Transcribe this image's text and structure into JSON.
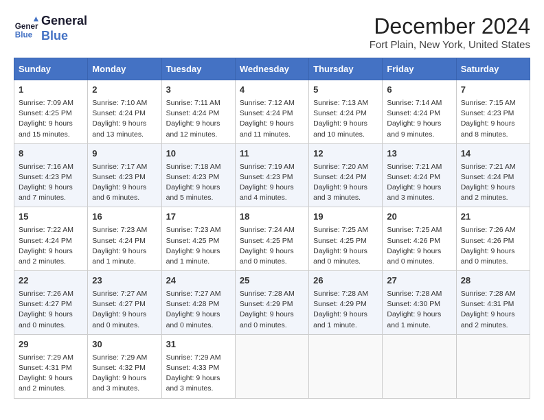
{
  "header": {
    "logo_line1": "General",
    "logo_line2": "Blue",
    "month_title": "December 2024",
    "location": "Fort Plain, New York, United States"
  },
  "weekdays": [
    "Sunday",
    "Monday",
    "Tuesday",
    "Wednesday",
    "Thursday",
    "Friday",
    "Saturday"
  ],
  "weeks": [
    [
      {
        "day": "1",
        "info": "Sunrise: 7:09 AM\nSunset: 4:25 PM\nDaylight: 9 hours and 15 minutes."
      },
      {
        "day": "2",
        "info": "Sunrise: 7:10 AM\nSunset: 4:24 PM\nDaylight: 9 hours and 13 minutes."
      },
      {
        "day": "3",
        "info": "Sunrise: 7:11 AM\nSunset: 4:24 PM\nDaylight: 9 hours and 12 minutes."
      },
      {
        "day": "4",
        "info": "Sunrise: 7:12 AM\nSunset: 4:24 PM\nDaylight: 9 hours and 11 minutes."
      },
      {
        "day": "5",
        "info": "Sunrise: 7:13 AM\nSunset: 4:24 PM\nDaylight: 9 hours and 10 minutes."
      },
      {
        "day": "6",
        "info": "Sunrise: 7:14 AM\nSunset: 4:24 PM\nDaylight: 9 hours and 9 minutes."
      },
      {
        "day": "7",
        "info": "Sunrise: 7:15 AM\nSunset: 4:23 PM\nDaylight: 9 hours and 8 minutes."
      }
    ],
    [
      {
        "day": "8",
        "info": "Sunrise: 7:16 AM\nSunset: 4:23 PM\nDaylight: 9 hours and 7 minutes."
      },
      {
        "day": "9",
        "info": "Sunrise: 7:17 AM\nSunset: 4:23 PM\nDaylight: 9 hours and 6 minutes."
      },
      {
        "day": "10",
        "info": "Sunrise: 7:18 AM\nSunset: 4:23 PM\nDaylight: 9 hours and 5 minutes."
      },
      {
        "day": "11",
        "info": "Sunrise: 7:19 AM\nSunset: 4:23 PM\nDaylight: 9 hours and 4 minutes."
      },
      {
        "day": "12",
        "info": "Sunrise: 7:20 AM\nSunset: 4:24 PM\nDaylight: 9 hours and 3 minutes."
      },
      {
        "day": "13",
        "info": "Sunrise: 7:21 AM\nSunset: 4:24 PM\nDaylight: 9 hours and 3 minutes."
      },
      {
        "day": "14",
        "info": "Sunrise: 7:21 AM\nSunset: 4:24 PM\nDaylight: 9 hours and 2 minutes."
      }
    ],
    [
      {
        "day": "15",
        "info": "Sunrise: 7:22 AM\nSunset: 4:24 PM\nDaylight: 9 hours and 2 minutes."
      },
      {
        "day": "16",
        "info": "Sunrise: 7:23 AM\nSunset: 4:24 PM\nDaylight: 9 hours and 1 minute."
      },
      {
        "day": "17",
        "info": "Sunrise: 7:23 AM\nSunset: 4:25 PM\nDaylight: 9 hours and 1 minute."
      },
      {
        "day": "18",
        "info": "Sunrise: 7:24 AM\nSunset: 4:25 PM\nDaylight: 9 hours and 0 minutes."
      },
      {
        "day": "19",
        "info": "Sunrise: 7:25 AM\nSunset: 4:25 PM\nDaylight: 9 hours and 0 minutes."
      },
      {
        "day": "20",
        "info": "Sunrise: 7:25 AM\nSunset: 4:26 PM\nDaylight: 9 hours and 0 minutes."
      },
      {
        "day": "21",
        "info": "Sunrise: 7:26 AM\nSunset: 4:26 PM\nDaylight: 9 hours and 0 minutes."
      }
    ],
    [
      {
        "day": "22",
        "info": "Sunrise: 7:26 AM\nSunset: 4:27 PM\nDaylight: 9 hours and 0 minutes."
      },
      {
        "day": "23",
        "info": "Sunrise: 7:27 AM\nSunset: 4:27 PM\nDaylight: 9 hours and 0 minutes."
      },
      {
        "day": "24",
        "info": "Sunrise: 7:27 AM\nSunset: 4:28 PM\nDaylight: 9 hours and 0 minutes."
      },
      {
        "day": "25",
        "info": "Sunrise: 7:28 AM\nSunset: 4:29 PM\nDaylight: 9 hours and 0 minutes."
      },
      {
        "day": "26",
        "info": "Sunrise: 7:28 AM\nSunset: 4:29 PM\nDaylight: 9 hours and 1 minute."
      },
      {
        "day": "27",
        "info": "Sunrise: 7:28 AM\nSunset: 4:30 PM\nDaylight: 9 hours and 1 minute."
      },
      {
        "day": "28",
        "info": "Sunrise: 7:28 AM\nSunset: 4:31 PM\nDaylight: 9 hours and 2 minutes."
      }
    ],
    [
      {
        "day": "29",
        "info": "Sunrise: 7:29 AM\nSunset: 4:31 PM\nDaylight: 9 hours and 2 minutes."
      },
      {
        "day": "30",
        "info": "Sunrise: 7:29 AM\nSunset: 4:32 PM\nDaylight: 9 hours and 3 minutes."
      },
      {
        "day": "31",
        "info": "Sunrise: 7:29 AM\nSunset: 4:33 PM\nDaylight: 9 hours and 3 minutes."
      },
      {
        "day": "",
        "info": ""
      },
      {
        "day": "",
        "info": ""
      },
      {
        "day": "",
        "info": ""
      },
      {
        "day": "",
        "info": ""
      }
    ]
  ]
}
